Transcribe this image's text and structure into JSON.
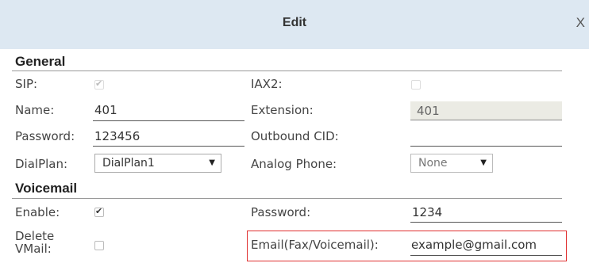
{
  "dialog": {
    "title": "Edit",
    "close_label": "X"
  },
  "general": {
    "heading": "General",
    "sip_label": "SIP:",
    "iax2_label": "IAX2:",
    "name_label": "Name:",
    "name_value": "401",
    "extension_label": "Extension:",
    "extension_value": "401",
    "password_label": "Password:",
    "password_value": "123456",
    "outbound_cid_label": "Outbound CID:",
    "outbound_cid_value": "",
    "dialplan_label": "DialPlan:",
    "dialplan_value": "DialPlan1",
    "analog_phone_label": "Analog Phone:",
    "analog_phone_value": "None"
  },
  "voicemail": {
    "heading": "Voicemail",
    "enable_label": "Enable:",
    "password_label": "Password:",
    "password_value": "1234",
    "delete_label_line1": "Delete",
    "delete_label_line2": "VMail:",
    "email_label": "Email(Fax/Voicemail):",
    "email_value": "example@gmail.com"
  }
}
